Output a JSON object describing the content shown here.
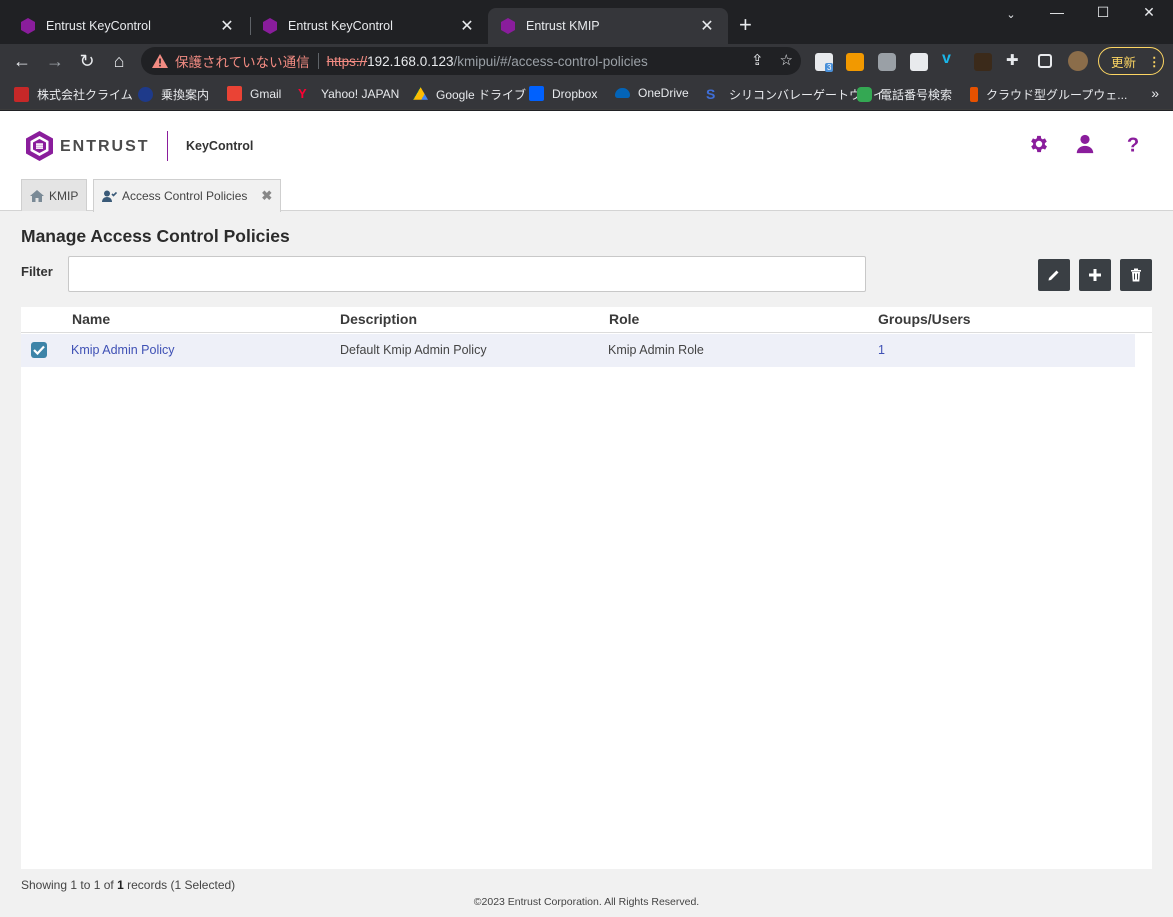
{
  "browser": {
    "tabs": [
      {
        "title": "Entrust KeyControl"
      },
      {
        "title": "Entrust KeyControl"
      },
      {
        "title": "Entrust KMIP"
      }
    ],
    "security_warning": "保護されていない通信",
    "url_scheme": "https://",
    "url_host": "192.168.0.123",
    "url_path": "/kmipui/#/access-control-policies",
    "update_label": "更新",
    "extension_badge": "3",
    "bookmarks": [
      {
        "label": "株式会社クライム",
        "icon": "climb-icon"
      },
      {
        "label": "乗換案内",
        "icon": "transit-icon"
      },
      {
        "label": "Gmail",
        "icon": "gmail-icon"
      },
      {
        "label": "Yahoo! JAPAN",
        "icon": "yahoo-icon"
      },
      {
        "label": "Google ドライブ",
        "icon": "google-drive-icon"
      },
      {
        "label": "Dropbox",
        "icon": "dropbox-icon"
      },
      {
        "label": "OneDrive",
        "icon": "onedrive-icon"
      },
      {
        "label": "シリコンバレーゲートウェイ",
        "icon": "svg-icon"
      },
      {
        "label": "電話番号検索",
        "icon": "phone-search-icon"
      },
      {
        "label": "クラウド型グループウェ...",
        "icon": "groupware-icon"
      }
    ]
  },
  "app": {
    "brand": "ENTRUST",
    "product": "KeyControl",
    "tabs": [
      {
        "label": "KMIP"
      },
      {
        "label": "Access Control Policies"
      }
    ],
    "page_title": "Manage Access Control Policies",
    "filter": {
      "label": "Filter",
      "value": "",
      "placeholder": ""
    },
    "columns": [
      "Name",
      "Description",
      "Role",
      "Groups/Users"
    ],
    "rows": [
      {
        "name": "Kmip Admin Policy",
        "description": "Default Kmip Admin Policy",
        "role": "Kmip Admin Role",
        "groups_users": "1",
        "selected": true
      }
    ],
    "status": {
      "prefix": "Showing 1 to 1 of",
      "total": "1",
      "suffix": "records (1 Selected)"
    },
    "copyright": "©2023 Entrust Corporation. All Rights Reserved.",
    "accent_color": "#8a1d9c"
  }
}
